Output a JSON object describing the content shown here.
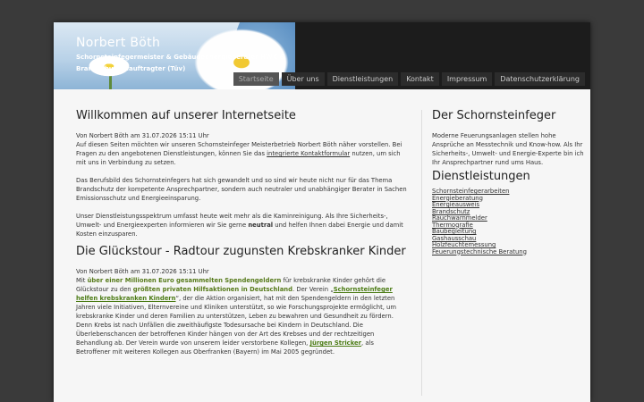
{
  "header": {
    "title": "Norbert Böth",
    "subtitle": "Schornsteinfegermeister & Gebäudeenergieberater HWK & Brandschutzbeauftragter (Tüv)"
  },
  "nav": {
    "items": [
      {
        "label": "Startseite"
      },
      {
        "label": "Über uns"
      },
      {
        "label": "Dienstleistungen"
      },
      {
        "label": "Kontakt"
      },
      {
        "label": "Impressum"
      },
      {
        "label": "Datenschutzerklärung"
      }
    ]
  },
  "main": {
    "article1": {
      "title": "Willkommen auf unserer Internetseite",
      "meta": "Von Norbert Böth am 31.07.2026 15:11 Uhr",
      "p1_text1": "Auf diesen Seiten möchten wir unseren Schornsteinfeger Meisterbetrieb Norbert Böth näher vorstellen. Bei Fragen zu den angebotenen Dienstleistungen, können Sie das ",
      "p1_link": "integrierte Kontaktformular",
      "p1_text2": " nutzen, um sich mit uns in Verbindung zu setzen.",
      "p2": "Das Berufsbild des Schornsteinfegers hat sich gewandelt und so sind wir heute nicht nur für das Thema Brandschutz der kompetente Ansprechpartner, sondern auch neutraler und unabhängiger Berater in Sachen Emissionsschutz und Energieeinsparung.",
      "p3_text1": "Unser Dienstleistungsspektrum umfasst heute weit mehr als die Kaminreinigung. Als Ihre Sicherheits-, Umwelt- und Energieexperten informieren wir Sie gerne ",
      "p3_bold": "neutral",
      "p3_text2": " und helfen Ihnen dabei Energie und damit Kosten einzusparen."
    },
    "article2": {
      "title": "Die Glückstour - Radtour zugunsten Krebskranker Kinder",
      "meta": "Von Norbert Böth am 31.07.2026 15:11 Uhr",
      "t1": "Mit ",
      "g1": "über einer Millionen Euro gesammelten Spendengeldern",
      "t2": " für krebskranke Kinder gehört die Glückstour zu den ",
      "g2": "größten privaten Hilfsaktionen in Deutschland",
      "t3": ". Der Verein „",
      "l1": "Schornsteinfeger helfen krebskranken Kindern",
      "t4": "“, der die Aktion organisiert, hat mit den Spendengeldern in den letzten Jahren viele Initiativen, Elternvereine und Kliniken unterstützt, so wie Forschungsprojekte ermöglicht, um krebskranke Kinder und deren Familien zu unterstützen, Leben zu bewahren und Gesundheit zu fördern. Denn Krebs ist nach Unfällen die zweithäufigste Todesursache bei Kindern in Deutschland. Die Überlebenschancen der betroffenen Kinder hängen von der Art des Krebses und der rechtzeitigen Behandlung ab. Der Verein wurde von unserem leider verstorbene Kollegen, ",
      "l2": "Jürgen Stricker",
      "t5": ", als Betroffener mit weiteren Kollegen aus Oberfranken (Bayern) im Mai 2005 gegründet."
    }
  },
  "sidebar": {
    "title1": "Der Schornsteinfeger",
    "text1": "Moderne Feuerungsanlagen stellen hohe Ansprüche an Messtechnik und Know-how. Als Ihr Sicherheits-, Umwelt- und Energie-Experte bin ich Ihr Ansprechpartner rund ums Haus.",
    "title2": "Dienstleistungen",
    "links": [
      "Schornsteinfegerarbeiten",
      "Energieberatung",
      "Energieausweis",
      "Brandschutz",
      "Rauchwarnmelder",
      "Thermografie",
      "Baubegleitung",
      "Gashausschau",
      "Holzfeuchtemessung",
      "Feuerungstechnische Beratung"
    ]
  },
  "colors": {
    "background": "#3a3a3a",
    "header": "#1c1c1c",
    "accent_green": "#567a1a"
  }
}
